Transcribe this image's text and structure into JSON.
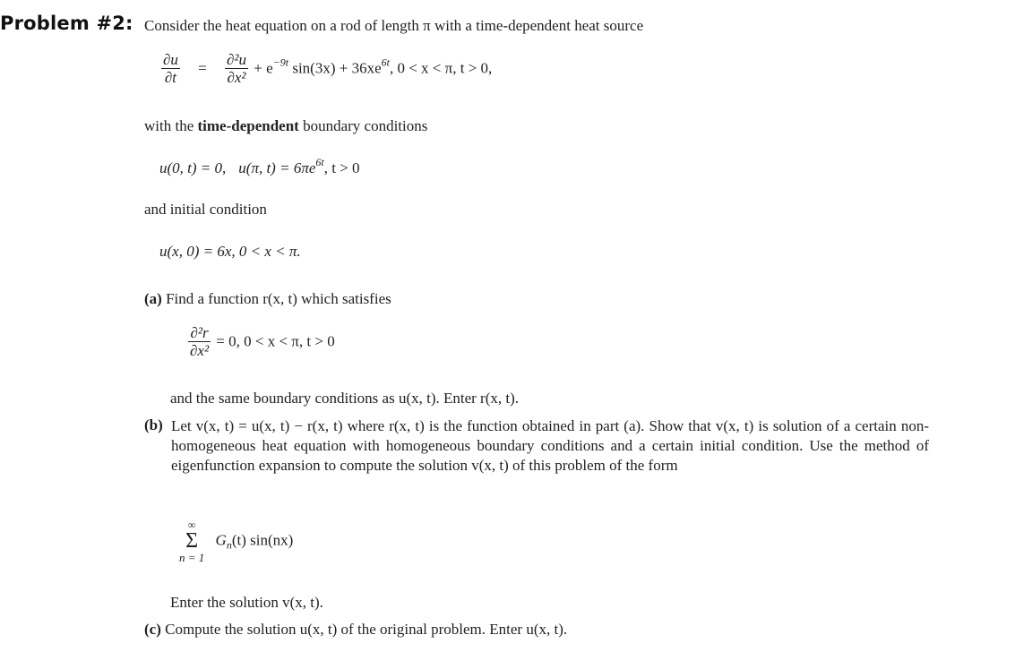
{
  "problem": {
    "title": "Problem #2:",
    "intro": "Consider the heat equation on a rod of length π with a time-dependent heat source",
    "pde": {
      "lhs_num": "∂u",
      "lhs_den": "∂t",
      "equals": "=",
      "rhs_num": "∂²u",
      "rhs_den": "∂x²",
      "source_term_1": "+ e",
      "source_exp_1": "−9t",
      "source_term_2": " sin(3x) + 36xe",
      "source_exp_2": "6t",
      "domain": ",   0 < x < π,   t > 0,"
    },
    "bc_intro_pre": "with the ",
    "bc_intro_bold": "time-dependent",
    "bc_intro_post": " boundary conditions",
    "bc": {
      "left": "u(0, t) = 0,",
      "right": "u(π, t) = 6πe",
      "right_exp": "6t",
      "cond": ",   t > 0"
    },
    "ic_intro": "and initial condition",
    "ic": "u(x, 0) = 6x,   0 < x < π.",
    "part_a": {
      "label": "(a)",
      "text": "Find a function r(x, t) which satisfies",
      "eq_num": "∂²r",
      "eq_den": "∂x²",
      "eq_rest": "= 0,   0 < x < π,   t > 0",
      "followup": "and the same boundary conditions as u(x, t). Enter r(x, t)."
    },
    "part_b": {
      "label": "(b)",
      "text": "Let v(x, t) = u(x, t) − r(x, t) where r(x, t) is the function obtained in part (a). Show that v(x, t) is solution of a certain non-homogeneous heat equation with homogeneous boundary conditions and a certain initial condition. Use the method of eigenfunction expansion to compute the solution v(x, t) of this problem of the form",
      "sum_top": "∞",
      "sum_sigma": "Σ",
      "sum_bottom": "n = 1",
      "sum_term": "G",
      "sum_sub": "n",
      "sum_rest": "(t) sin(nx)",
      "followup": "Enter the solution v(x, t)."
    },
    "part_c": {
      "label": "(c)",
      "text": "Compute the solution u(x, t) of the original problem. Enter u(x, t)."
    }
  }
}
